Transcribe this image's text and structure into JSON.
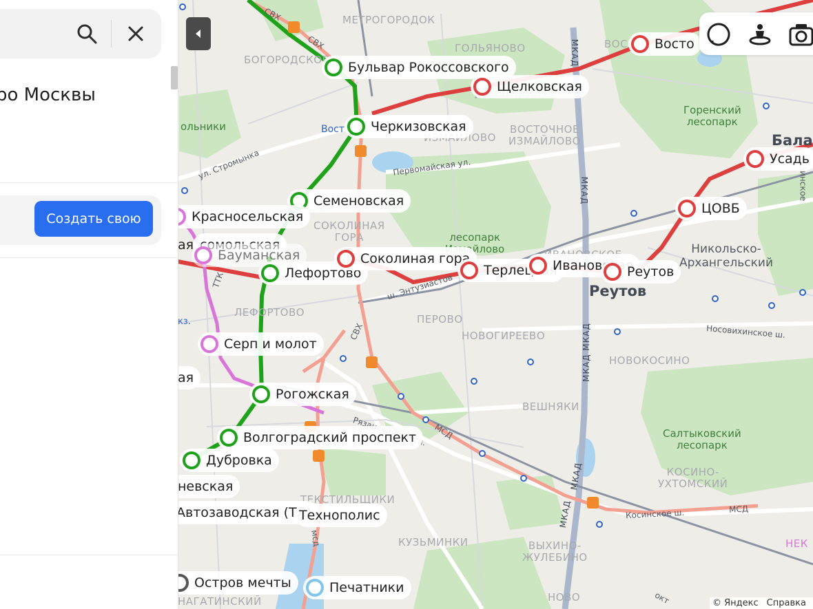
{
  "sidebar": {
    "title": "ро Москвы",
    "create_button": "Создать свою"
  },
  "toolbar": {
    "icons": [
      "traffic-layer-icon",
      "panorama-person-icon",
      "photo-camera-icon"
    ]
  },
  "attribution": {
    "copyright": "© Яндекс",
    "help": "Справка"
  },
  "colors": {
    "line_green": "#1ea21a",
    "line_red": "#dd3f3f",
    "line_pink": "#d975d8",
    "line_blue": "#7fc6ea",
    "rail": "#f4a091",
    "primary_button": "#2a6ef0",
    "park": "#cde6c2"
  },
  "stations": {
    "bulvar_rokossovskogo": "Бульвар Рокоссовского",
    "shchelkovskaya": "Щелковская",
    "vostochnaya": "Восто",
    "cherkizovskaya": "Черкизовская",
    "semenovskaya": "Семеновская",
    "krasnoselskaya": "Красносельская",
    "komsomolskaya": "сомольская",
    "kaya_left": "ая",
    "baumanskaya": "Бауманская",
    "lefortovo": "Лефортово",
    "sokolinaya_gora": "Соколиная гора",
    "terletskaya": "Терлецкая",
    "ivanovskaya": "Ивановская",
    "reutov": "Реутов",
    "tsovb": "ЦОВБ",
    "usadba": "Усадь",
    "serp_i_molot": "Серп и молот",
    "kaya_left2": "ая",
    "rogozhskaya": "Рогожская",
    "volgogradsky": "Волгоградский проспект",
    "dubrovka": "Дубровка",
    "nevskaya": "невская",
    "avtozavodskaya": "Автозаводская (ТЛ)",
    "tekhnopolis": "Технополис",
    "ostrov_mechty": "Остров мечты",
    "pechatniki": "Печатники"
  },
  "districts": {
    "metrogorodok": "МЕТРОГОРОДОК",
    "golyanovo": "ГОЛЬЯНОВО",
    "bogorodskoe": "БОГОРОДСКОЕ",
    "voc": "ВОС",
    "izmailovo": "ИЗМАЙЛОВО",
    "vostochnoe_izmailovo": "ВОСТОЧНОЕ\nИЗМАЙЛОВО",
    "sokolinaya_gora": "СОКОЛИНАЯ\nГОРА",
    "lefortovo": "ЛЕФОРТОВО",
    "perovo": "ПЕРОВО",
    "novogireevo": "НОВОГИРЕЕВО",
    "novokosino": "НОВОКОСИНО",
    "veshnyaki": "ВЕШНЯКИ",
    "kosino_ukhtomsky": "КОСИНО-\nУХТОМСКИЙ",
    "tekstilshchiki": "ТЕКСТИЛЬЩИКИ",
    "kuzminki": "КУЗЬМИНКИ",
    "vykhino_zhulebino": "ВЫХИНО-\nЖУЛЕБИНО",
    "nagatinsky": "НАГАТИНСКИЙ",
    "novo": "НОВО",
    "olnyki": "ольники",
    "izmailovo_partial": "ИЗМАЙЛОВО",
    "ivanovskoe": "ИВАНОВСКОЕ"
  },
  "parks": {
    "gorensky": "Горенский\nлесопарк",
    "izmailovo": "лесопарк\nИзмайлово",
    "saltykovsky": "Салтыковский\nлесопарк"
  },
  "towns": {
    "reutov": "Реутов",
    "nikolsko": "Никольско-\nАрхангельский",
    "bala": "Бала"
  },
  "streets": {
    "svh1": "СВХ",
    "svh2": "СВХ",
    "svh3": "СВХ",
    "stromynka": "ул. Стромынка",
    "pervomaiskaya": "Первомайская ул.",
    "entuziastov": "ш. Энтузиастов",
    "nosovikhinskoe": "Носовихинское ш.",
    "ryazansky": "Рязанский просп.",
    "msd1": "МСД",
    "msd2": "МСД",
    "kosinskoe": "Косинское ш.",
    "ttk": "ТТК",
    "mkad1": "МКАД",
    "mkad2": "МКАД",
    "mkad3": "МКАД МКАД",
    "mkad4": "МКАД",
    "mkad5": "МКАД",
    "vost": "Вост",
    "ksk": "кз.",
    "zinskoe": "зинское",
    "msd_small": "мсд",
    "okt": "окт",
    "nek": "НЕК"
  }
}
